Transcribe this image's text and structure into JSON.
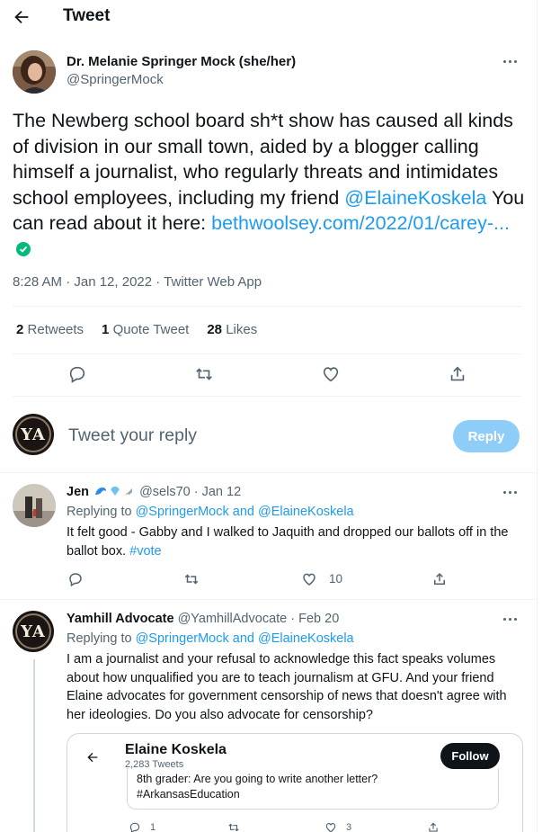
{
  "header": {
    "title": "Tweet"
  },
  "tweet": {
    "author_name": "Dr. Melanie Springer Mock (she/her)",
    "author_handle": "@SpringerMock",
    "text_part1": "The Newberg school board sh*t show has caused all kinds of division in our small town, aided by a blogger calling himself a journalist, who regularly threats and intimidates school employees, including my friend ",
    "mention": "@ElaineKoskela",
    "text_part2": " You can read about it here: ",
    "link": "bethwoolsey.com/2022/01/carey-...",
    "timestamp": "8:28 AM · Jan 12, 2022 · Twitter Web App",
    "retweets_count": "2",
    "retweets_label": "Retweets",
    "quotes_count": "1",
    "quotes_label": "Quote Tweet",
    "likes_count": "28",
    "likes_label": "Likes"
  },
  "composer": {
    "avatar_initials": "YA",
    "placeholder": "Tweet your reply",
    "button": "Reply"
  },
  "replies": [
    {
      "name": "Jen",
      "handle": "@sels70",
      "date": "· Jan 12",
      "replying_label": "Replying to",
      "replying_to": "@SpringerMock and @ElaineKoskela",
      "text": "It felt good - Gabby and I walked to Jaquith and dropped our ballots off in the ballot box. ",
      "hashtag": "#vote",
      "likes": "10"
    },
    {
      "avatar_initials": "YA",
      "name": "Yamhill Advocate",
      "handle": "@YamhillAdvocate",
      "date": "· Feb 20",
      "replying_label": "Replying to",
      "replying_to": "@SpringerMock and @ElaineKoskela",
      "text": "I am a journalist and your refusal to acknowledge this fact speaks volumes about how unqualified you are to teach journalism at GFU. And your friend Elaine advocates for government censorship of news that doesn't agree with her ideologies. Do you also advocate for censorship?",
      "embed": {
        "name": "Elaine Koskela",
        "sub": "2,283 Tweets",
        "follow": "Follow",
        "quote_line1": "8th grader: Are you going to write another letter?",
        "quote_line2": "#ArkansasEducation",
        "reply_count": "1",
        "like_count": "3"
      }
    }
  ],
  "colors": {
    "accent": "#1d9bf0",
    "text": "#0f1419",
    "secondary": "#536471",
    "verified": "#00ba7c"
  }
}
